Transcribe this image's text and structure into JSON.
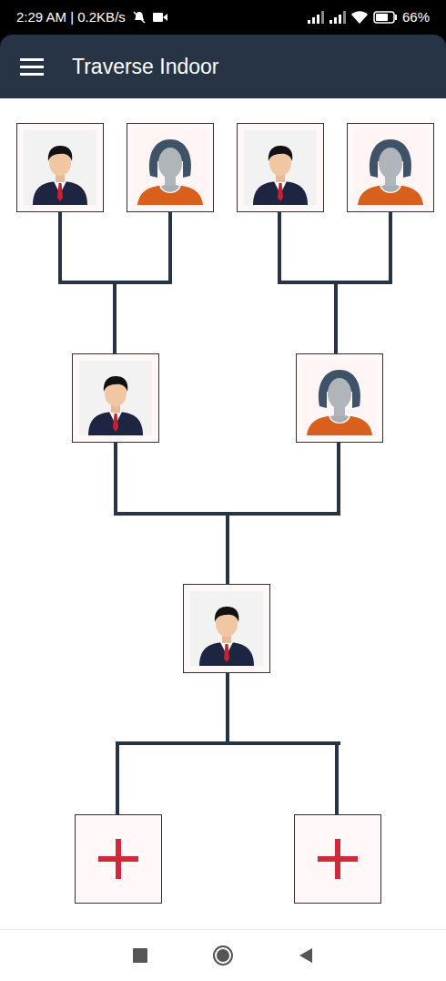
{
  "status_bar": {
    "time": "2:29 AM | 0.2KB/s",
    "battery": "66%"
  },
  "app_bar": {
    "title": "Traverse Indoor"
  },
  "tree": {
    "grandparents": [
      {
        "kind": "male"
      },
      {
        "kind": "female"
      },
      {
        "kind": "male"
      },
      {
        "kind": "female"
      }
    ],
    "parents": [
      {
        "kind": "male"
      },
      {
        "kind": "female"
      }
    ],
    "self": [
      {
        "kind": "male"
      }
    ],
    "children": [
      {
        "kind": "add"
      },
      {
        "kind": "add"
      }
    ]
  }
}
